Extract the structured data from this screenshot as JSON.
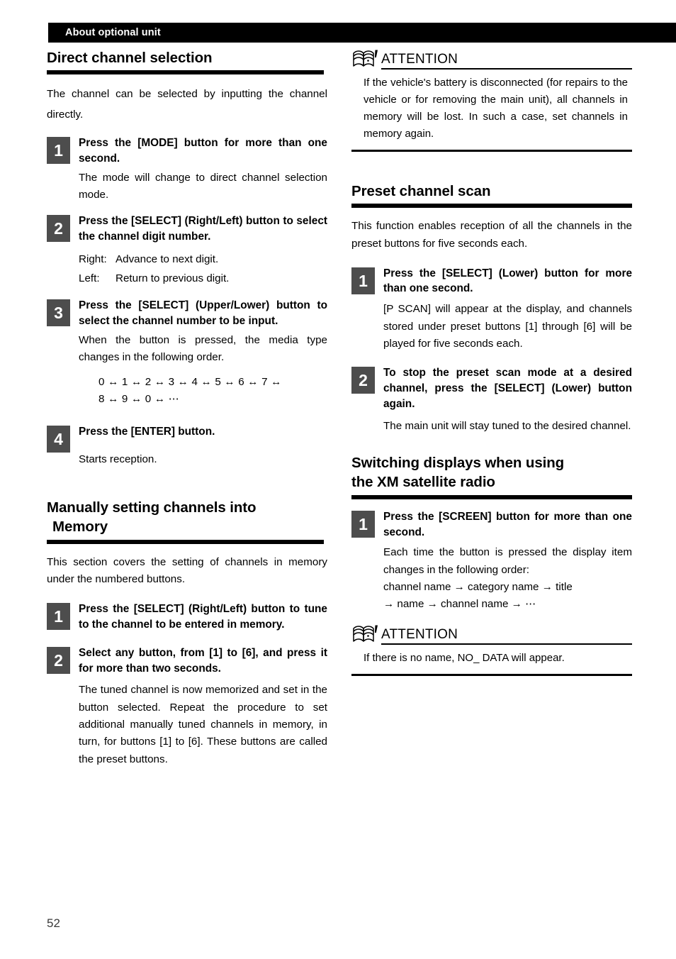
{
  "header": {
    "running_title": "About optional unit"
  },
  "page_number": "52",
  "colors": {
    "header_bar": "#000000",
    "step_badge": "#4d4d4d",
    "rule": "#000000",
    "text": "#000000"
  },
  "left_column": {
    "section1": {
      "heading": "Direct channel selection",
      "intro": "The channel can be selected by inputting the channel directly.",
      "steps": [
        {
          "number": "1",
          "title": "Press the [MODE] button for more than one second.",
          "body": "The mode will change to direct channel selection mode."
        },
        {
          "number": "2",
          "title": "Press the [SELECT] (Right/Left) button to select the channel digit number.",
          "rows": [
            {
              "key": "Right:",
              "value": "Advance to next digit."
            },
            {
              "key": "Left:",
              "value": "Return to previous digit."
            }
          ]
        },
        {
          "number": "3",
          "title": "Press the [SELECT] (Upper/Lower) button to select the channel number to be input.",
          "body": "When the button is pressed, the media type changes in the following order.",
          "sequence_line1": "0 ↔ 1 ↔ 2 ↔ 3 ↔ 4 ↔ 5 ↔ 6 ↔ 7 ↔",
          "sequence_line2": "8 ↔ 9 ↔ 0 ↔ ⋯"
        },
        {
          "number": "4",
          "title": "Press the [ENTER] button.",
          "body": "Starts reception."
        }
      ]
    },
    "section2": {
      "heading_line1": "Manually setting channels into",
      "heading_line2": "Memory",
      "intro": "This section covers the setting of channels in memory under the numbered buttons.",
      "steps": [
        {
          "number": "1",
          "title": "Press the [SELECT] (Right/Left) button to tune to the channel to be entered in memory."
        },
        {
          "number": "2",
          "title": "Select any button, from [1] to [6], and press it for more than two seconds.",
          "body": "The tuned channel is now memorized and set in the button selected. Repeat the procedure to set additional manually tuned channels in memory, in turn, for buttons [1] to [6]. These buttons are called the preset buttons."
        }
      ]
    }
  },
  "right_column": {
    "attention_top": {
      "icon": "open-book-attention-icon",
      "title": "ATTENTION",
      "body": "If the vehicle's battery is disconnected (for repairs to the vehicle or for removing the main unit), all channels in memory will be lost. In such a case, set channels in memory again."
    },
    "section3": {
      "heading": "Preset channel scan",
      "intro": "This function enables reception of all the channels in the preset buttons for five seconds each.",
      "steps": [
        {
          "number": "1",
          "title": "Press the [SELECT] (Lower) button for more than one second.",
          "body": "[P SCAN] will appear at the display, and channels stored under preset buttons [1] through [6] will be played for five seconds each."
        },
        {
          "number": "2",
          "title": "To stop the preset scan mode at a desired channel, press the [SELECT] (Lower) button again.",
          "body": "The main unit will stay tuned to the desired channel."
        }
      ]
    },
    "section4": {
      "heading_line1": "Switching displays when using",
      "heading_line2": "the XM satellite radio",
      "steps": [
        {
          "number": "1",
          "title": "Press the [SCREEN] button for more than one second.",
          "body": "Each time the button is pressed the display item changes in the following order:",
          "sequence_line1": "channel name → category name → title",
          "sequence_line2": "→ name → channel name → ⋯"
        }
      ]
    },
    "attention_bottom": {
      "icon": "open-book-attention-icon",
      "title": "ATTENTION",
      "body": "If there is no name, NO_ DATA will appear."
    }
  }
}
